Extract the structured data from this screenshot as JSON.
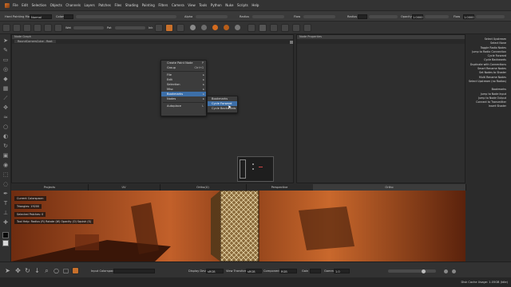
{
  "menubar": {
    "items": [
      "File",
      "Edit",
      "Selection",
      "Objects",
      "Channels",
      "Layers",
      "Patches",
      "Files",
      "Shading",
      "Painting",
      "Filters",
      "Camera",
      "View",
      "Tools",
      "Python",
      "Nuke",
      "Scripts",
      "Help"
    ]
  },
  "toolbar": {
    "hard_label": "Hard",
    "painting_mode_label": "Painting Mode",
    "painting_mode_value": "Normal",
    "colors_label": "Colors",
    "alpha_label": "Alpha",
    "radius_label": "Radius",
    "flow_label": "Flow",
    "radius2_label": "Radius",
    "opacity_label": "Opacity",
    "opacity_value": "1.0000",
    "flow2_label": "Flow",
    "flow2_value": "1.0000",
    "wet_label": "Wet",
    "pat_label": "Pat",
    "ink_label": "Ink"
  },
  "node_graph": {
    "header": "Node Graph",
    "tab": "RoundCornersCube - Root"
  },
  "node_properties": {
    "header": "Node Properties"
  },
  "context_menu": {
    "items": [
      {
        "label": "Create Paint Node",
        "shortcut": "P",
        "submenu": false
      },
      {
        "label": "Group",
        "shortcut": "Ctrl+G",
        "submenu": false
      },
      {
        "label": "File",
        "shortcut": "",
        "submenu": true
      },
      {
        "label": "Edit",
        "shortcut": "",
        "submenu": true
      },
      {
        "label": "Selection",
        "shortcut": "",
        "submenu": true
      },
      {
        "label": "Misc",
        "shortcut": "",
        "submenu": true
      },
      {
        "label": "Bookmarks",
        "shortcut": "",
        "submenu": true
      },
      {
        "label": "Nodes",
        "shortcut": "",
        "submenu": true
      },
      {
        "label": "Autoplace",
        "shortcut": "L",
        "submenu": false
      }
    ],
    "bookmarks_submenu": [
      "Bookmarks",
      "Cycle Forward",
      "Cycle Backwards"
    ]
  },
  "right_shortcuts": {
    "group1": [
      "Select Upstream",
      "Select None",
      "Toggle Radio Nodes",
      "Jump to Radio Connection",
      "Cycle Forward",
      "Cycle Backwards",
      "Duplicate with Connections",
      "Smart Rename Nodes",
      "Set Nodes to Shader",
      "Multi Rename Nodes",
      "Select Upstream (no Radios)"
    ],
    "group2": [
      "Bookmarks",
      "Jump to Node Input",
      "Jump to Node Output",
      "Connect to Transmitter",
      "Insert Shader"
    ]
  },
  "view_tabs": [
    "Projects",
    "UV",
    "Ortho(U)",
    "Perspective",
    "Ortho"
  ],
  "viewport": {
    "hud": [
      "Current Colorspace:",
      "Triangles: 19200",
      "Selected Patches: 0",
      "Tool Help:  Radius (R)  Rotate (W)  Opacity (O)  Squish (S)"
    ]
  },
  "bottombar": {
    "colorspace_label": "Input Colorspace",
    "display_device_label": "Display Device",
    "display_device_value": "sRGB",
    "view_transform_label": "View Transform",
    "view_transform_value": "sRGB",
    "component_label": "Component",
    "component_value": "RGB",
    "gain_label": "Gain",
    "gamma_label": "Gamma",
    "gamma_value": "1.0"
  },
  "status": {
    "text": "Disk Cache Usage: 1.05GB (Idle)"
  },
  "colors": {
    "accent": "#c8702b",
    "highlight": "#3d6fa8"
  }
}
